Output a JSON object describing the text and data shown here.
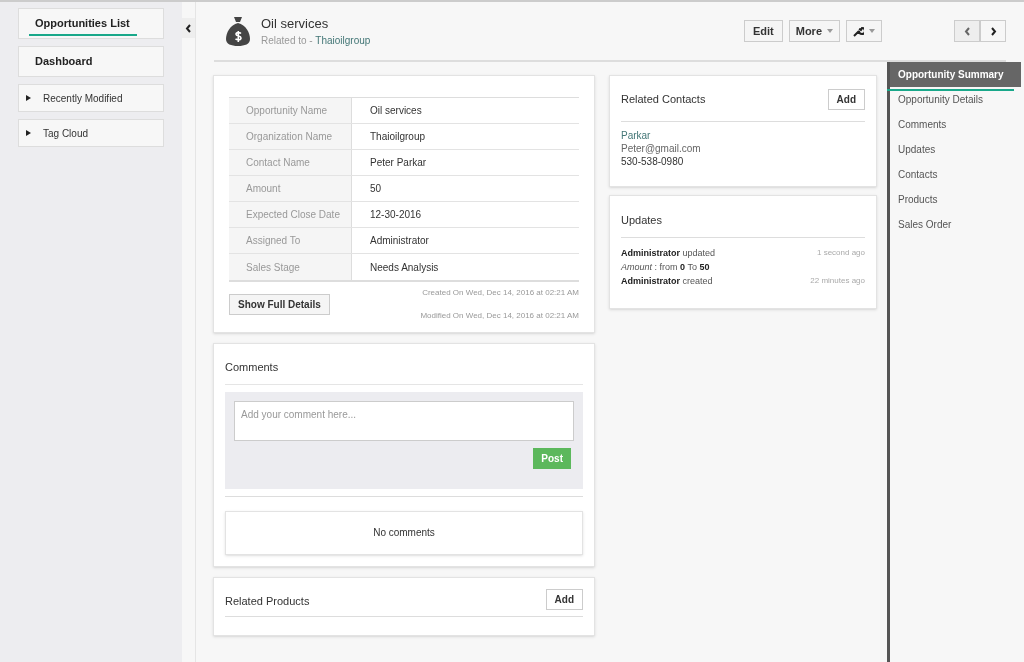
{
  "sidebar": {
    "items": [
      {
        "label": "Opportunities List",
        "kind": "link",
        "selected": true
      },
      {
        "label": "Dashboard",
        "kind": "link",
        "selected": false
      },
      {
        "label": "Recently Modified",
        "kind": "collapsible",
        "expanded": false
      },
      {
        "label": "Tag Cloud",
        "kind": "collapsible",
        "expanded": false
      }
    ]
  },
  "header": {
    "title": "Oil services",
    "related_label": "Related to - ",
    "related_link": "Thaioilgroup",
    "buttons": [
      {
        "kind": "text",
        "label": "Edit"
      },
      {
        "kind": "dropdown",
        "label": "More"
      },
      {
        "kind": "wrench"
      }
    ]
  },
  "details": {
    "fields": [
      {
        "label": "Opportunity Name",
        "value": "Oil services"
      },
      {
        "label": "Organization Name",
        "value": "Thaioilgroup"
      },
      {
        "label": "Contact Name",
        "value": "Peter Parkar"
      },
      {
        "label": "Amount",
        "value": "50"
      },
      {
        "label": "Expected Close Date",
        "value": "12-30-2016"
      },
      {
        "label": "Assigned To",
        "value": "Administrator"
      },
      {
        "label": "Sales Stage",
        "value": "Needs Analysis"
      }
    ],
    "button": "Show Full Details",
    "created": "Created On Wed, Dec 14, 2016 at 02:21 AM",
    "modified": "Modified On Wed, Dec 14, 2016 at 02:21 AM"
  },
  "comments": {
    "title": "Comments",
    "placeholder": "Add your comment here...",
    "post": "Post",
    "empty": "No comments"
  },
  "related_products": {
    "title": "Related Products",
    "add": "Add"
  },
  "related_contacts": {
    "title": "Related Contacts",
    "add": "Add",
    "name": "Parkar",
    "email": "Peter@gmail.com",
    "phone": "530-538-0980"
  },
  "updates": {
    "title": "Updates",
    "entries": [
      {
        "text": "**Administrator** updated",
        "time": "1 second ago"
      },
      {
        "text": "*Amount* :  from **0** To **50**"
      },
      {
        "text": "**Administrator** created",
        "time": "22 minutes ago"
      }
    ]
  },
  "section_nav": {
    "items": [
      {
        "label": "Opportunity Summary",
        "selected": true
      },
      {
        "label": "Opportunity Details",
        "selected": false
      },
      {
        "label": "Comments",
        "selected": false
      },
      {
        "label": "Updates",
        "selected": false
      },
      {
        "label": "Contacts",
        "selected": false
      },
      {
        "label": "Products",
        "selected": false
      },
      {
        "label": "Sales Order",
        "selected": false
      }
    ]
  }
}
